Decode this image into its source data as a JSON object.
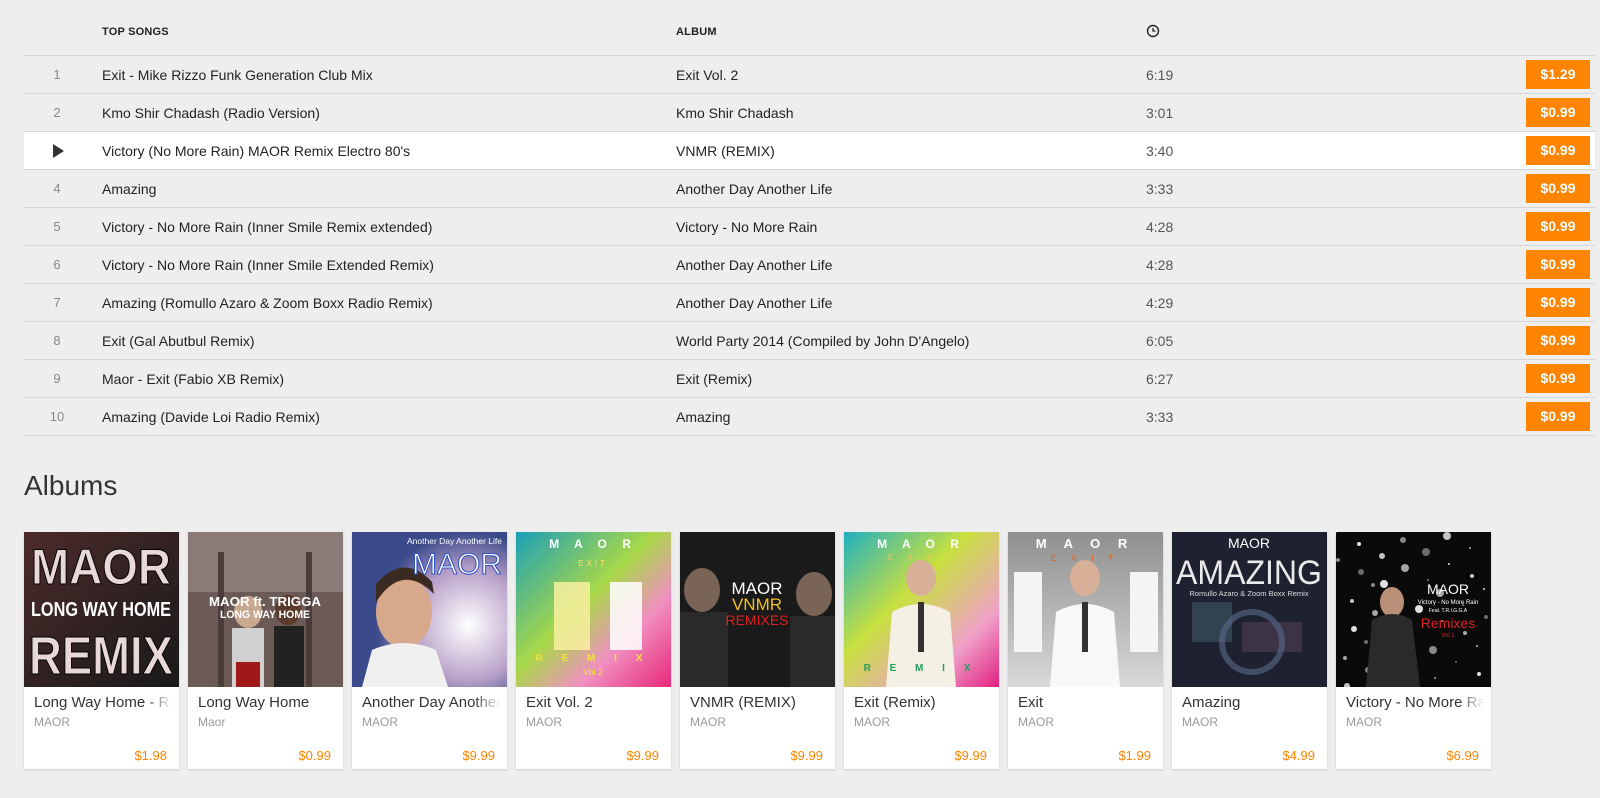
{
  "songs_table": {
    "title_header": "TOP SONGS",
    "album_header": "ALBUM",
    "duration_header_icon": "clock-icon",
    "price_color": "#ff8400",
    "rows": [
      {
        "num": "1",
        "title": "Exit - Mike Rizzo Funk Generation Club Mix",
        "album": "Exit Vol. 2",
        "duration": "6:19",
        "price": "$1.29",
        "playing": false
      },
      {
        "num": "2",
        "title": "Kmo Shir Chadash (Radio Version)",
        "album": "Kmo Shir Chadash",
        "duration": "3:01",
        "price": "$0.99",
        "playing": false
      },
      {
        "num": "",
        "title": "Victory (No More Rain) MAOR Remix Electro 80's",
        "album": "VNMR (REMIX)",
        "duration": "3:40",
        "price": "$0.99",
        "playing": true
      },
      {
        "num": "4",
        "title": "Amazing",
        "album": "Another Day Another Life",
        "duration": "3:33",
        "price": "$0.99",
        "playing": false
      },
      {
        "num": "5",
        "title": "Victory - No More Rain (Inner Smile Remix extended)",
        "album": "Victory - No More Rain",
        "duration": "4:28",
        "price": "$0.99",
        "playing": false
      },
      {
        "num": "6",
        "title": "Victory - No More Rain (Inner Smile Extended Remix)",
        "album": "Another Day Another Life",
        "duration": "4:28",
        "price": "$0.99",
        "playing": false
      },
      {
        "num": "7",
        "title": "Amazing (Romullo Azaro & Zoom Boxx Radio Remix)",
        "album": "Another Day Another Life",
        "duration": "4:29",
        "price": "$0.99",
        "playing": false
      },
      {
        "num": "8",
        "title": "Exit (Gal Abutbul Remix)",
        "album": "World Party 2014 (Compiled by John D'Angelo)",
        "duration": "6:05",
        "price": "$0.99",
        "playing": false
      },
      {
        "num": "9",
        "title": "Maor - Exit (Fabio XB Remix)",
        "album": "Exit (Remix)",
        "duration": "6:27",
        "price": "$0.99",
        "playing": false
      },
      {
        "num": "10",
        "title": "Amazing (Davide Loi Radio Remix)",
        "album": "Amazing",
        "duration": "3:33",
        "price": "$0.99",
        "playing": false
      }
    ]
  },
  "albums_section": {
    "heading": "Albums",
    "items": [
      {
        "title": "Long Way Home - Remix",
        "artist": "MAOR",
        "price": "$1.98",
        "cover": {
          "style": "a",
          "lines": [
            "MAOR",
            "LONG WAY HOME",
            "REMIX"
          ]
        }
      },
      {
        "title": "Long Way Home",
        "artist": "Maor",
        "price": "$0.99",
        "cover": {
          "style": "b",
          "lines": [
            "MAOR ft. TRIGGA",
            "LONG WAY HOME"
          ]
        }
      },
      {
        "title": "Another Day Another Life",
        "artist": "MAOR",
        "price": "$9.99",
        "cover": {
          "style": "c",
          "lines": [
            "Another Day Another Life",
            "MAOR"
          ]
        }
      },
      {
        "title": "Exit Vol. 2",
        "artist": "MAOR",
        "price": "$9.99",
        "cover": {
          "style": "d",
          "lines": [
            "M A O R",
            "EXIT",
            "R E M I X",
            "Vol 2"
          ]
        }
      },
      {
        "title": "VNMR (REMIX)",
        "artist": "MAOR",
        "price": "$9.99",
        "cover": {
          "style": "e",
          "lines": [
            "MAOR",
            "VNMR",
            "REMIXES"
          ]
        }
      },
      {
        "title": "Exit (Remix)",
        "artist": "MAOR",
        "price": "$9.99",
        "cover": {
          "style": "f",
          "lines": [
            "M A O R",
            "E X I T",
            "R E M I X"
          ]
        }
      },
      {
        "title": "Exit",
        "artist": "MAOR",
        "price": "$1.99",
        "cover": {
          "style": "g",
          "lines": [
            "M A O R",
            "E X I T"
          ]
        }
      },
      {
        "title": "Amazing",
        "artist": "MAOR",
        "price": "$4.99",
        "cover": {
          "style": "h",
          "lines": [
            "MAOR",
            "AMAZING",
            "Romullo Azaro & Zoom Boxx Remix"
          ]
        }
      },
      {
        "title": "Victory - No More Rain",
        "artist": "MAOR",
        "price": "$6.99",
        "cover": {
          "style": "i",
          "lines": [
            "MAOR",
            "Victory - No More Rain",
            "Feat. T.R.I.G.G.A",
            "Remixes",
            "Vol 1"
          ]
        }
      }
    ]
  }
}
